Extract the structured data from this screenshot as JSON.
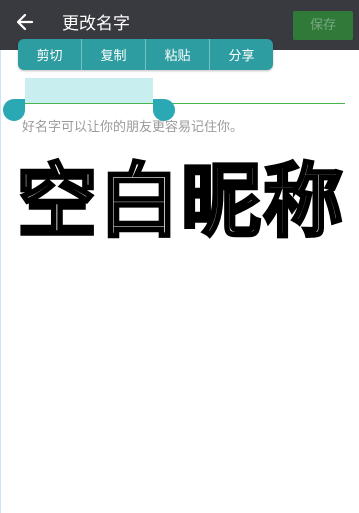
{
  "header": {
    "title": "更改名字",
    "save_label": "保存",
    "back_icon": "arrow-left-icon"
  },
  "context_menu": {
    "items": [
      "剪切",
      "复制",
      "粘贴",
      "分享"
    ]
  },
  "name_input": {
    "hint": "好名字可以让你的朋友更容易记住你。"
  },
  "overlay_text": "空白昵称",
  "colors": {
    "topbar": "#393a3f",
    "save_button": "#2f7a39",
    "context_menu": "#2d9da1",
    "selection": "#c9eef0",
    "handle": "#2aa8b3",
    "underline": "#47b64c"
  }
}
